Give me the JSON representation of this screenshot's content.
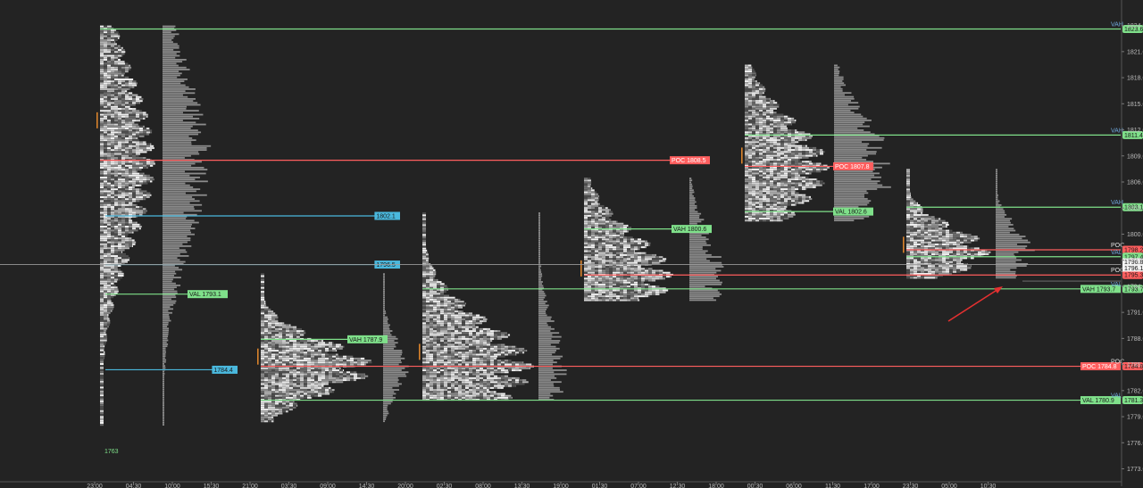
{
  "chart_data": {
    "type": "market-profile",
    "y_axis": {
      "range": [
        1771.0,
        1825.5
      ],
      "ticks": [
        "1824.0",
        "1821.0",
        "1818.0",
        "1815.0",
        "1812.0",
        "1809.0",
        "1806.0",
        "1803.0",
        "1800.0",
        "1797.0",
        "1794.0",
        "1791.0",
        "1788.0",
        "1785.0",
        "1782.0",
        "1779.0",
        "1776.0",
        "1773.0"
      ],
      "current_price": 1796.5,
      "price_labels": [
        {
          "text": "1796.8",
          "value": 1796.8
        },
        {
          "text": "1796.1",
          "value": 1796.1
        }
      ]
    },
    "x_axis": {
      "tick_labels": [
        "23:00",
        "04:30",
        "10:00",
        "15:30",
        "21:00",
        "03:30",
        "09:00",
        "14:30",
        "20:00",
        "02:30",
        "08:00",
        "13:30",
        "19:00",
        "01:30",
        "07:00",
        "12:30",
        "18:00",
        "00:30",
        "06:00",
        "11:30",
        "17:00",
        "23:30",
        "05:00",
        "10:30"
      ]
    },
    "sessions": [
      {
        "low": 1778.0,
        "high": 1824.0
      },
      {
        "low": 1778.5,
        "high": 1795.5
      },
      {
        "low": 1781.0,
        "high": 1802.5
      },
      {
        "low": 1792.5,
        "high": 1806.5
      },
      {
        "low": 1801.5,
        "high": 1819.5
      },
      {
        "low": 1795.0,
        "high": 1807.5
      }
    ],
    "levels": [
      {
        "kind": "VAH",
        "text": "",
        "value": 1823.6,
        "color": "#7fe08a",
        "axis_text": "1823.6",
        "axis_tag": "VAH"
      },
      {
        "kind": "POC",
        "text": "POC 1808.5",
        "value": 1808.5,
        "color": "#ff5e5e"
      },
      {
        "kind": "level",
        "text": "1802.1",
        "value": 1802.1,
        "color": "#4ab8dd"
      },
      {
        "kind": "level",
        "text": "1796.5",
        "value": 1796.5,
        "color": "#4ab8dd"
      },
      {
        "kind": "VAL",
        "text": "VAL 1793.1",
        "value": 1793.1,
        "color": "#7fe08a"
      },
      {
        "kind": "level",
        "text": "1784.4",
        "value": 1784.4,
        "color": "#4ab8dd"
      },
      {
        "kind": "VAH",
        "text": "VAH 1787.9",
        "value": 1787.9,
        "color": "#7fe08a"
      },
      {
        "kind": "POC",
        "text": "POC 1784.8",
        "value": 1784.8,
        "color": "#ff5e5e",
        "axis_text": "1784.8",
        "axis_tag": "POC"
      },
      {
        "kind": "VAL",
        "text": "VAL 1780.9",
        "value": 1780.9,
        "color": "#7fe08a",
        "axis_text": "1781.3",
        "axis_tag": "VAL"
      },
      {
        "kind": "VAH",
        "text": "VAH 1793.7",
        "value": 1793.7,
        "color": "#7fe08a",
        "axis_text": "1793.7",
        "axis_tag": "VAL"
      },
      {
        "kind": "POC",
        "text": "",
        "value": 1795.3,
        "color": "#ff5e5e",
        "axis_text": "1795.3",
        "axis_tag": "POC"
      },
      {
        "kind": "VAH",
        "text": "VAH 1800.6",
        "value": 1800.6,
        "color": "#7fe08a"
      },
      {
        "kind": "VAH",
        "text": "",
        "value": 1811.4,
        "color": "#7fe08a",
        "axis_text": "1811.4",
        "axis_tag": "VAH"
      },
      {
        "kind": "POC",
        "text": "POC 1807.8",
        "value": 1807.8,
        "color": "#ff5e5e"
      },
      {
        "kind": "VAL",
        "text": "VAL 1802.6",
        "value": 1802.6,
        "color": "#7fe08a"
      },
      {
        "kind": "VAH",
        "text": "",
        "value": 1803.1,
        "color": "#7fe08a",
        "axis_text": "1803.1",
        "axis_tag": "VAH"
      },
      {
        "kind": "POC",
        "text": "",
        "value": 1798.2,
        "color": "#ff5e5e",
        "axis_text": "1798.2",
        "axis_tag": "POC"
      },
      {
        "kind": "VAL",
        "text": "",
        "value": 1797.4,
        "color": "#7fe08a",
        "axis_text": "1797.4",
        "axis_tag": "VAL"
      }
    ],
    "annotation": {
      "text": "1763",
      "color": "#7fe08a"
    },
    "arrow": {
      "color": "#e53030"
    },
    "grid": false,
    "legend": "none",
    "colors": {
      "background": "#232323",
      "profile_light": "#e8e8e8",
      "profile_dark": "#5a5a5a",
      "volume": "#8a8a8a"
    }
  }
}
